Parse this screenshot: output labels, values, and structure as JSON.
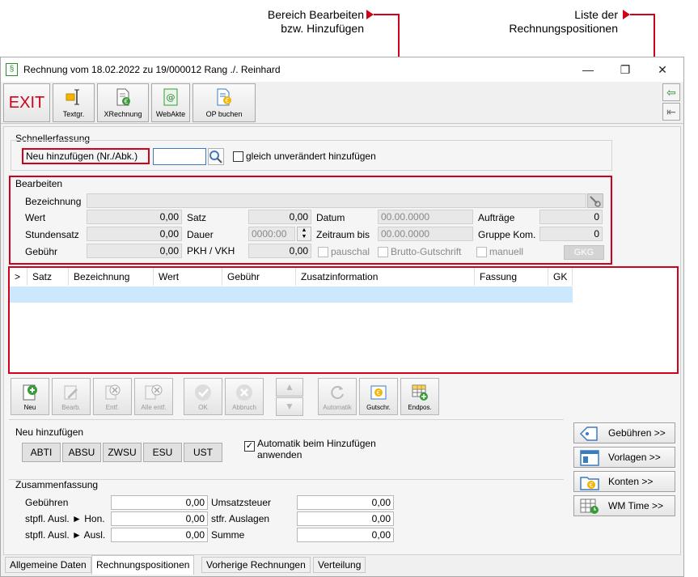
{
  "callouts": {
    "edit_area": "Bereich Bearbeiten\nbzw. Hinzufügen",
    "list": "Liste der\nRechnungspositionen"
  },
  "window": {
    "title": "Rechnung vom 18.02.2022 zu 19/000012  Rang ./. Reinhard",
    "min": "—",
    "max": "❐",
    "close": "✕"
  },
  "toolbar": {
    "exit": "EXIT",
    "textgr": "Textgr.",
    "xrechnung": "XRechnung",
    "webakte": "WebAkte",
    "op_buchen": "OP buchen"
  },
  "schnell": {
    "title": "Schnellerfassung",
    "neu_label": "Neu hinzufügen (Nr./Abk.)",
    "input_value": "",
    "gleich_label": "gleich unverändert hinzufügen"
  },
  "bearbeiten": {
    "title": "Bearbeiten",
    "bezeichnung_label": "Bezeichnung",
    "bezeichnung_value": "",
    "wert_label": "Wert",
    "wert_value": "0,00",
    "stundensatz_label": "Stundensatz",
    "stundensatz_value": "0,00",
    "gebuehr_label": "Gebühr",
    "gebuehr_value": "0,00",
    "satz_label": "Satz",
    "satz_value": "0,00",
    "dauer_label": "Dauer",
    "dauer_value": "0000:00",
    "pkh_label": "PKH / VKH",
    "pkh_value": "0,00",
    "datum_label": "Datum",
    "datum_value": "00.00.0000",
    "zeitraum_label": "Zeitraum bis",
    "zeitraum_value": "00.00.0000",
    "auftraege_label": "Aufträge",
    "auftraege_value": "0",
    "gruppe_label": "Gruppe Kom.",
    "gruppe_value": "0",
    "pauschal_label": "pauschal",
    "brutto_label": "Brutto-Gutschrift",
    "manuell_label": "manuell",
    "gkg_label": "GKG"
  },
  "grid": {
    "columns": [
      ">",
      "Satz",
      "Bezeichnung",
      "Wert",
      "Gebühr",
      "Zusatzinformation",
      "Fassung",
      "GK"
    ]
  },
  "actions": {
    "neu": "Neu",
    "bearb": "Bearb.",
    "entf": "Entf.",
    "alle_entf": "Alle entf.",
    "ok": "OK",
    "abbruch": "Abbruch",
    "up": "▲",
    "down": "▼",
    "automatik": "Automatik",
    "gutschr": "Gutschr.",
    "endpos": "Endpos."
  },
  "neu_hinzufuegen": {
    "title": "Neu hinzufügen",
    "buttons": [
      "ABTI",
      "ABSU",
      "ZWSU",
      "ESU",
      "UST"
    ],
    "automatik_label": "Automatik beim Hinzufügen anwenden",
    "automatik_checked": true
  },
  "zusammenfassung": {
    "title": "Zusammenfassung",
    "gebuehren_label": "Gebühren",
    "gebuehren_value": "0,00",
    "stpfl_hon_label": "stpfl. Ausl. ► Hon.",
    "stpfl_hon_value": "0,00",
    "stpfl_ausl_label": "stpfl. Ausl. ► Ausl.",
    "stpfl_ausl_value": "0,00",
    "umsatzsteuer_label": "Umsatzsteuer",
    "umsatzsteuer_value": "0,00",
    "stfr_label": "stfr. Auslagen",
    "stfr_value": "0,00",
    "summe_label": "Summe",
    "summe_value": "0,00"
  },
  "right_buttons": {
    "gebuehren": "Gebühren >>",
    "vorlagen": "Vorlagen >>",
    "konten": "Konten >>",
    "wm_time": "WM Time >>"
  },
  "tabs": [
    "Allgemeine Daten",
    "Rechnungspositionen",
    "Vorherige Rechnungen",
    "Verteilung"
  ],
  "colors": {
    "accent_red": "#d0021b",
    "selection": "#cce8ff"
  }
}
